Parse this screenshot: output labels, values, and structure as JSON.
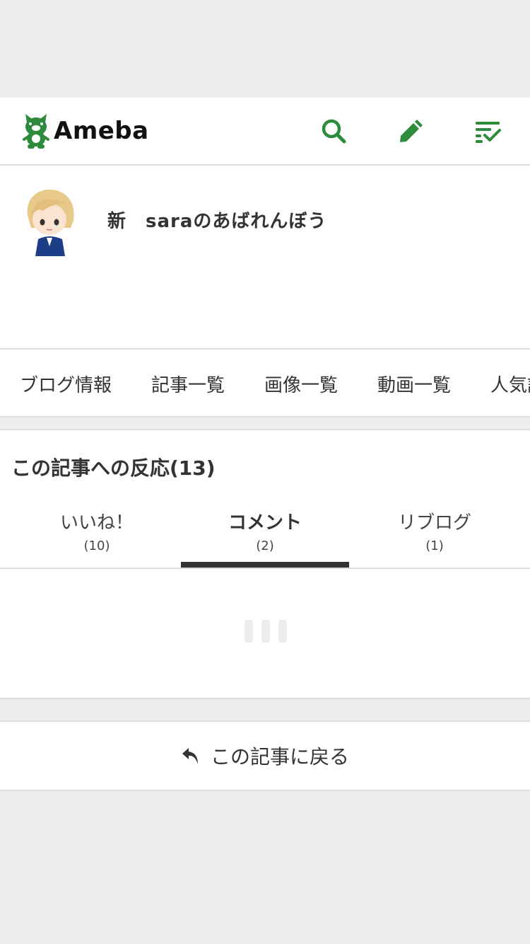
{
  "header": {
    "logo_text": "Ameba",
    "accent_color": "#2d8c3c",
    "icons": [
      "search-icon",
      "pencil-icon",
      "checklist-icon"
    ]
  },
  "profile": {
    "blog_title": "新　saraのあばれんぼう"
  },
  "nav": {
    "items": [
      "ブログ情報",
      "記事一覧",
      "画像一覧",
      "動画一覧",
      "人気記"
    ]
  },
  "reactions": {
    "heading": "この記事への反応(13)",
    "tabs": [
      {
        "label": "いいね！",
        "count": "(10)"
      },
      {
        "label": "コメント",
        "count": "(2)"
      },
      {
        "label": "リブログ",
        "count": "(1)"
      }
    ],
    "active_tab": "コメント"
  },
  "back": {
    "label": "この記事に戻る",
    "icon": "reply-arrow-icon"
  }
}
